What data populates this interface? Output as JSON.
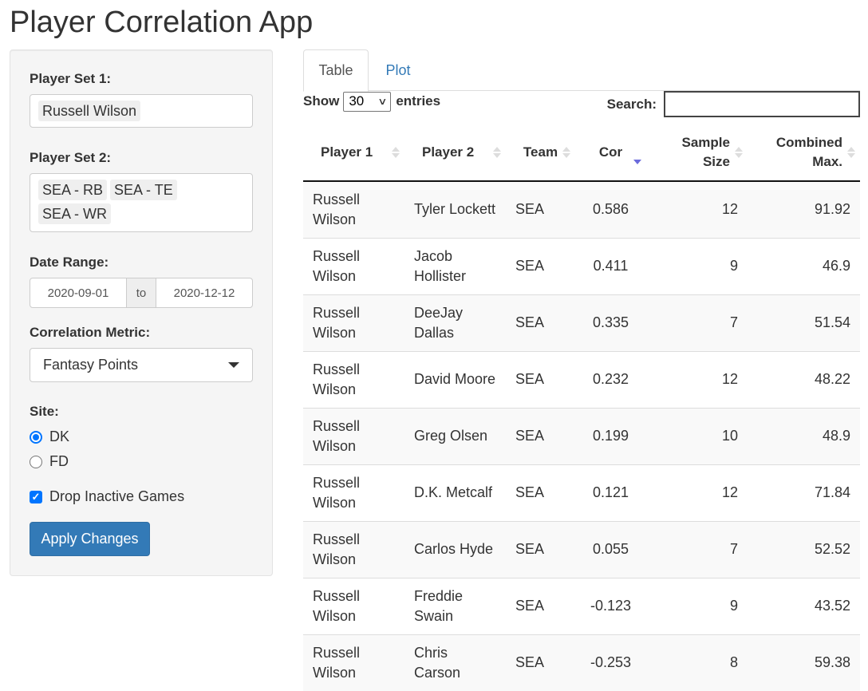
{
  "app": {
    "title": "Player Correlation App"
  },
  "sidebar": {
    "player_set_1": {
      "label": "Player Set 1:",
      "selected": [
        "Russell Wilson"
      ]
    },
    "player_set_2": {
      "label": "Player Set 2:",
      "selected": [
        "SEA - RB",
        "SEA - TE",
        "SEA - WR"
      ]
    },
    "date_range": {
      "label": "Date Range:",
      "start": "2020-09-01",
      "separator": "to",
      "end": "2020-12-12"
    },
    "correlation_metric": {
      "label": "Correlation Metric:",
      "selected": "Fantasy Points",
      "icon": "caret-down-icon"
    },
    "site": {
      "label": "Site:",
      "options": [
        {
          "label": "DK",
          "checked": true
        },
        {
          "label": "FD",
          "checked": false
        }
      ]
    },
    "drop_inactive": {
      "label": "Drop Inactive Games",
      "checked": true
    },
    "apply_button": "Apply Changes",
    "accent_color": "#337ab7"
  },
  "main": {
    "tabs": [
      {
        "label": "Table",
        "active": true
      },
      {
        "label": "Plot",
        "active": false
      }
    ],
    "length": {
      "prefix": "Show",
      "value": "30",
      "suffix": "entries"
    },
    "search": {
      "label": "Search:",
      "value": ""
    },
    "table": {
      "columns": [
        {
          "label": "Player 1",
          "sort": "none"
        },
        {
          "label": "Player 2",
          "sort": "none"
        },
        {
          "label": "Team",
          "sort": "none"
        },
        {
          "label": "Cor",
          "sort": "desc"
        },
        {
          "label": "Sample Size",
          "sort": "none"
        },
        {
          "label": "Combined Max.",
          "sort": "none"
        }
      ],
      "rows": [
        {
          "player1": "Russell Wilson",
          "player2": "Tyler Lockett",
          "team": "SEA",
          "cor": "0.586",
          "sample_size": "12",
          "combined_max": "91.92"
        },
        {
          "player1": "Russell Wilson",
          "player2": "Jacob Hollister",
          "team": "SEA",
          "cor": "0.411",
          "sample_size": "9",
          "combined_max": "46.9"
        },
        {
          "player1": "Russell Wilson",
          "player2": "DeeJay Dallas",
          "team": "SEA",
          "cor": "0.335",
          "sample_size": "7",
          "combined_max": "51.54"
        },
        {
          "player1": "Russell Wilson",
          "player2": "David Moore",
          "team": "SEA",
          "cor": "0.232",
          "sample_size": "12",
          "combined_max": "48.22"
        },
        {
          "player1": "Russell Wilson",
          "player2": "Greg Olsen",
          "team": "SEA",
          "cor": "0.199",
          "sample_size": "10",
          "combined_max": "48.9"
        },
        {
          "player1": "Russell Wilson",
          "player2": "D.K. Metcalf",
          "team": "SEA",
          "cor": "0.121",
          "sample_size": "12",
          "combined_max": "71.84"
        },
        {
          "player1": "Russell Wilson",
          "player2": "Carlos Hyde",
          "team": "SEA",
          "cor": "0.055",
          "sample_size": "7",
          "combined_max": "52.52"
        },
        {
          "player1": "Russell Wilson",
          "player2": "Freddie Swain",
          "team": "SEA",
          "cor": "-0.123",
          "sample_size": "9",
          "combined_max": "43.52"
        },
        {
          "player1": "Russell Wilson",
          "player2": "Chris Carson",
          "team": "SEA",
          "cor": "-0.253",
          "sample_size": "8",
          "combined_max": "59.38"
        }
      ]
    }
  }
}
